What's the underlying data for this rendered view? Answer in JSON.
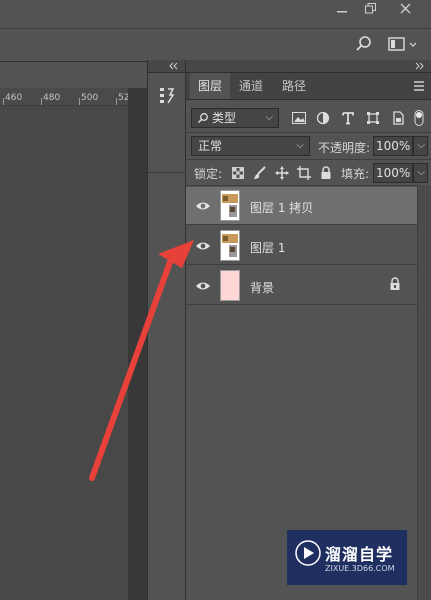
{
  "window": {
    "minimize_icon": "minimize-icon",
    "restore_icon": "restore-icon",
    "close_icon": "close-icon"
  },
  "optionsbar": {
    "search_icon": "search-icon",
    "workspace_icon": "workspace-icon"
  },
  "ruler": {
    "ticks": [
      "460",
      "480",
      "500",
      "52"
    ]
  },
  "layers_panel": {
    "tabs": [
      {
        "label": "图层",
        "active": true
      },
      {
        "label": "通道",
        "active": false
      },
      {
        "label": "路径",
        "active": false
      }
    ],
    "filter": {
      "value": "类型"
    },
    "blend_mode": {
      "value": "正常"
    },
    "opacity": {
      "label": "不透明度:",
      "value": "100%"
    },
    "lock": {
      "label": "锁定:"
    },
    "fill": {
      "label": "填充:",
      "value": "100%"
    },
    "layers": [
      {
        "name": "图层 1 拷贝",
        "selected": true,
        "visible": true,
        "locked": false
      },
      {
        "name": "图层 1",
        "selected": false,
        "visible": true,
        "locked": false
      },
      {
        "name": "背景",
        "selected": false,
        "visible": true,
        "locked": true
      }
    ]
  },
  "annotation": {
    "arrow_color": "#e8413a"
  },
  "watermark": {
    "name": "溜溜自学",
    "url": "ZIXUE.3D66.COM"
  },
  "colors": {
    "panel_bg": "#535353",
    "selected_row": "#6f6f6f",
    "background_layer_thumb": "#ffd6d6",
    "watermark_bg": "#1f3060"
  }
}
